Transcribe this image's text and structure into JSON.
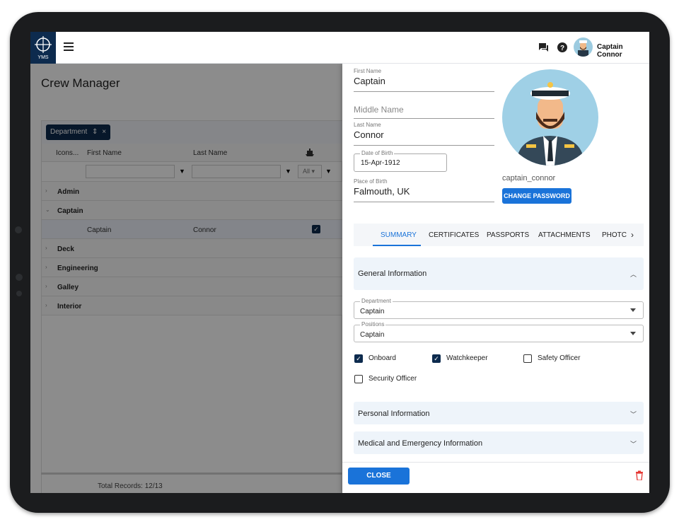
{
  "topbar": {
    "user_name": "Captain Connor",
    "logo_text": "YMS"
  },
  "page": {
    "title": "Crew Manager"
  },
  "grid": {
    "group_chip": "Department",
    "columns": [
      "Icons...",
      "First Name",
      "Last Name"
    ],
    "filter_all": "All",
    "groups": [
      "Admin",
      "Captain",
      "Deck",
      "Engineering",
      "Galley",
      "Interior"
    ],
    "row": {
      "first_name": "Captain",
      "last_name": "Connor"
    },
    "total_records": "Total Records: 12/13"
  },
  "detail": {
    "first_name_label": "First Name",
    "first_name": "Captain",
    "middle_name_placeholder": "Middle Name",
    "last_name_label": "Last Name",
    "last_name": "Connor",
    "dob_label": "Date of Birth",
    "dob": "15-Apr-1912",
    "pob_label": "Place of Birth",
    "pob": "Falmouth, UK",
    "username": "captain_connor",
    "change_password": "CHANGE PASSWORD",
    "tabs": [
      "SUMMARY",
      "CERTIFICATES",
      "PASSPORTS",
      "ATTACHMENTS",
      "PHOTC"
    ],
    "general_info": "General Information",
    "department_label": "Department",
    "department": "Captain",
    "positions_label": "Positions",
    "positions": "Captain",
    "checks": [
      {
        "label": "Onboard",
        "checked": true
      },
      {
        "label": "Watchkeeper",
        "checked": true
      },
      {
        "label": "Safety Officer",
        "checked": false
      },
      {
        "label": "Security Officer",
        "checked": false
      }
    ],
    "personal_info": "Personal Information",
    "medical_info": "Medical and Emergency Information",
    "close": "CLOSE"
  },
  "colors": {
    "accent": "#1a73d9",
    "navy": "#0d2b4e",
    "danger": "#e53935"
  }
}
